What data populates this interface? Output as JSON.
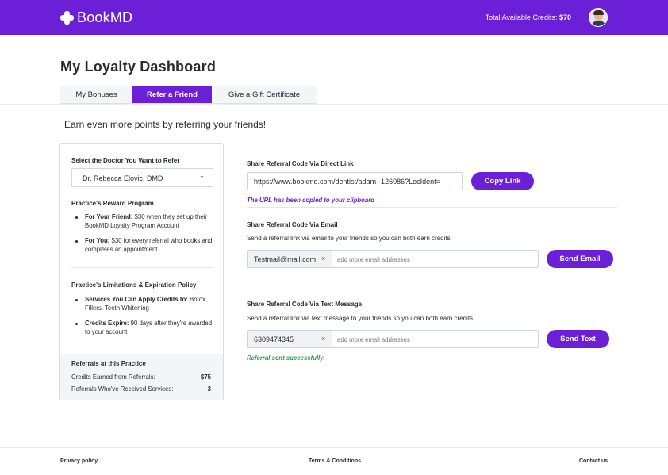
{
  "header": {
    "brand": "BookMD",
    "credits_label": "Total Available Credits:",
    "credits_value": "$70",
    "colors": {
      "brand": "#6b1fd6",
      "success": "#21a647"
    }
  },
  "page": {
    "title": "My Loyalty Dashboard",
    "subtitle": "Earn even more points by referring your friends!"
  },
  "tabs": [
    {
      "label": "My Bonuses",
      "active": false
    },
    {
      "label": "Refer a Friend",
      "active": true
    },
    {
      "label": "Give a Gift Certificate",
      "active": false
    }
  ],
  "sidebar": {
    "select_label": "Select the Doctor You Want to Refer",
    "selected_doctor": "Dr. Rebecca Elovic, DMD",
    "reward_title": "Practice's Reward Program",
    "reward_items": [
      {
        "bold": "For Your Friend:",
        "text": " $30 when they set up their BookMD Loyalty Program Account"
      },
      {
        "bold": "For You:",
        "text": " $30 for every referral who books and completes an appointment"
      }
    ],
    "limits_title": "Practice's Limitations & Expiration Policy",
    "limit_items": [
      {
        "bold": "Services You Can Apply Credits to:",
        "text": " Botox, Fillers, Teeth Whitening"
      },
      {
        "bold": "Credits Expire:",
        "text": " 90 days after they're awarded to your account"
      }
    ],
    "referrals_title": "Referrals at this Practice",
    "stats": [
      {
        "label": "Credits Earned from Referrals:",
        "value": "$75"
      },
      {
        "label": "Referrals Who've Received Services:",
        "value": "3"
      }
    ]
  },
  "direct_link": {
    "title": "Share Referral Code Via Direct Link",
    "url": "https://www.bookmd.com/dentist/adam--126086?LocIdent=",
    "button": "Copy Link",
    "notice": "The URL has been copied to your clipboard"
  },
  "email": {
    "title": "Share Referral Code Via Email",
    "description": "Send a referral link via email to your friends so you can both earn credits.",
    "chip": "Testmail@mail.com",
    "chip_remove": "×",
    "placeholder": "add more email addresses",
    "button": "Send Email"
  },
  "text_message": {
    "title": "Share Referral Code Via Text Message",
    "description": "Send a referral link via text message to your friends so you can both earn credits.",
    "chip": "6309474345",
    "chip_remove": "×",
    "placeholder": "add more email addresses",
    "button": "Send Text",
    "notice": "Referral sent successfully."
  },
  "footer": {
    "privacy": "Privacy policy",
    "terms": "Terms & Conditions",
    "contact": "Contact us"
  }
}
